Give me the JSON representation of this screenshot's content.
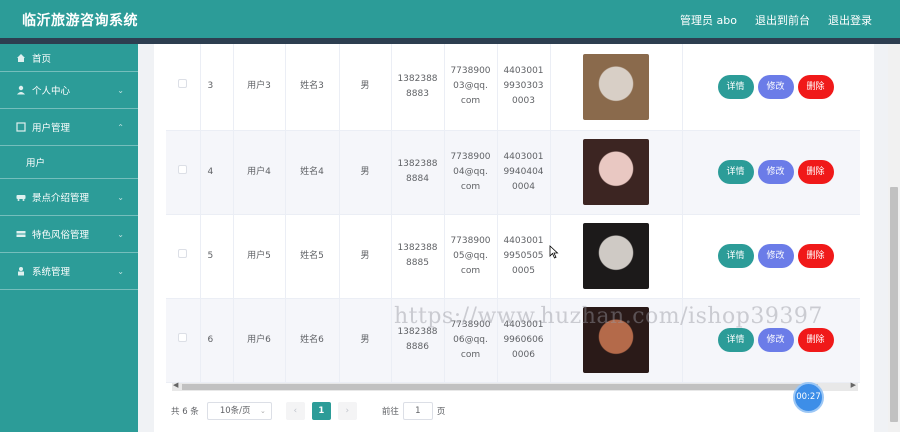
{
  "app": {
    "title": "临沂旅游咨询系统",
    "user_label": "管理员 abo",
    "back_label": "退出到前台",
    "logout_label": "退出登录"
  },
  "sidebar": {
    "items": [
      {
        "label": "首页",
        "icon": "home-icon"
      },
      {
        "label": "个人中心",
        "icon": "user-icon"
      },
      {
        "label": "用户管理",
        "icon": "square-icon",
        "sub": [
          "用户"
        ]
      },
      {
        "label": "景点介绍管理",
        "icon": "car-icon"
      },
      {
        "label": "特色风俗管理",
        "icon": "grid-icon"
      },
      {
        "label": "系统管理",
        "icon": "person-icon"
      }
    ]
  },
  "table": {
    "rows": [
      {
        "idx": "3",
        "user": "用户3",
        "name": "姓名3",
        "sex": "男",
        "phone": [
          "1382388",
          "8883"
        ],
        "email": [
          "7738900",
          "03@qq.",
          "com"
        ],
        "idcard": [
          "4403001",
          "9930303",
          "0003"
        ],
        "photo_colors": [
          "#d8cfc6",
          "#8a6a4c"
        ]
      },
      {
        "idx": "4",
        "user": "用户4",
        "name": "姓名4",
        "sex": "男",
        "phone": [
          "1382388",
          "8884"
        ],
        "email": [
          "7738900",
          "04@qq.",
          "com"
        ],
        "idcard": [
          "4403001",
          "9940404",
          "0004"
        ],
        "photo_colors": [
          "#e9c8c2",
          "#3c2522"
        ]
      },
      {
        "idx": "5",
        "user": "用户5",
        "name": "姓名5",
        "sex": "男",
        "phone": [
          "1382388",
          "8885"
        ],
        "email": [
          "7738900",
          "05@qq.",
          "com"
        ],
        "idcard": [
          "4403001",
          "9950505",
          "0005"
        ],
        "photo_colors": [
          "#cfcac5",
          "#1c1a1a"
        ]
      },
      {
        "idx": "6",
        "user": "用户6",
        "name": "姓名6",
        "sex": "男",
        "phone": [
          "1382388",
          "8886"
        ],
        "email": [
          "7738900",
          "06@qq.",
          "com"
        ],
        "idcard": [
          "4403001",
          "9960606",
          "0006"
        ],
        "photo_colors": [
          "#b46a4a",
          "#2a1a18"
        ]
      }
    ],
    "actions": {
      "detail": "详情",
      "edit": "修改",
      "delete": "删除"
    }
  },
  "pagination": {
    "total": "共 6 条",
    "page_size": "10条/页",
    "current_page": "1",
    "goto_label": "前往",
    "goto_value": "1",
    "page_suffix": "页"
  },
  "timer": "00:27",
  "watermark": "https://www.huzhan.com/ishop39397",
  "colors": {
    "primary": "#2c9c98",
    "edit": "#6b7ce8",
    "delete": "#f01919"
  }
}
